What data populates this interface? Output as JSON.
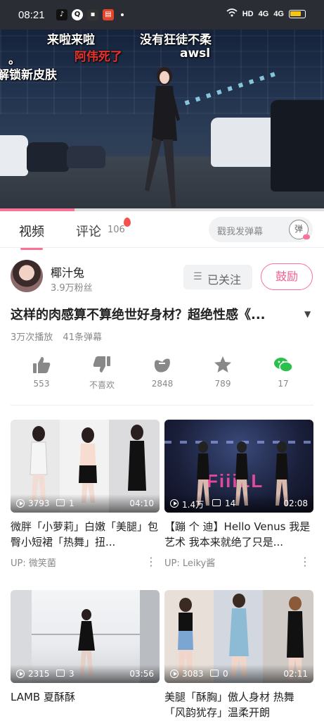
{
  "status_bar": {
    "time": "08:21",
    "network": "HD",
    "signal1": "4G",
    "signal2": "4G"
  },
  "video": {
    "danmaku": [
      "来啦来啦",
      "没有狂徒不柔",
      "阿伟死了",
      "awsl",
      "。",
      "解锁新皮肤"
    ],
    "progress": 0.23
  },
  "tabs": {
    "video_label": "视频",
    "comment_label": "评论",
    "comment_count": "106",
    "danmaku_placeholder": "戳我发弹幕",
    "danmaku_toggle": "弹"
  },
  "uploader": {
    "name": "椰汁兔",
    "fans": "3.9万粉丝",
    "follow_label": "已关注",
    "encourage_label": "鼓励"
  },
  "video_info": {
    "title": "这样的肉感算不算绝世好身材？超绝性感《...",
    "plays": "3万次播放",
    "danmaku_count": "41条弹幕"
  },
  "actions": {
    "like": "553",
    "dislike": "不喜欢",
    "coin": "2848",
    "favorite": "789",
    "share": "17"
  },
  "recommended": [
    {
      "views": "3793",
      "danmaku": "1",
      "duration": "04:10",
      "title": "微胖「小萝莉」白嫩「美腿」包臀小短裙「热舞」扭...",
      "up": "UP: 微笑菌"
    },
    {
      "views": "1.4万",
      "danmaku": "14",
      "duration": "02:08",
      "title": "【蹦 个 迪】Hello Venus 我是艺术 我本来就绝了只是...",
      "up": "UP: Leiky酱"
    },
    {
      "views": "2315",
      "danmaku": "3",
      "duration": "03:56",
      "title": "LAMB  夏酥酥",
      "up": ""
    },
    {
      "views": "3083",
      "danmaku": "0",
      "duration": "02:11",
      "title": "美腿「酥胸」傲人身材 热舞「风韵犹存」温柔开朗",
      "up": ""
    }
  ],
  "colors": {
    "accent": "#fb7299",
    "share_green": "#2bc04c"
  }
}
